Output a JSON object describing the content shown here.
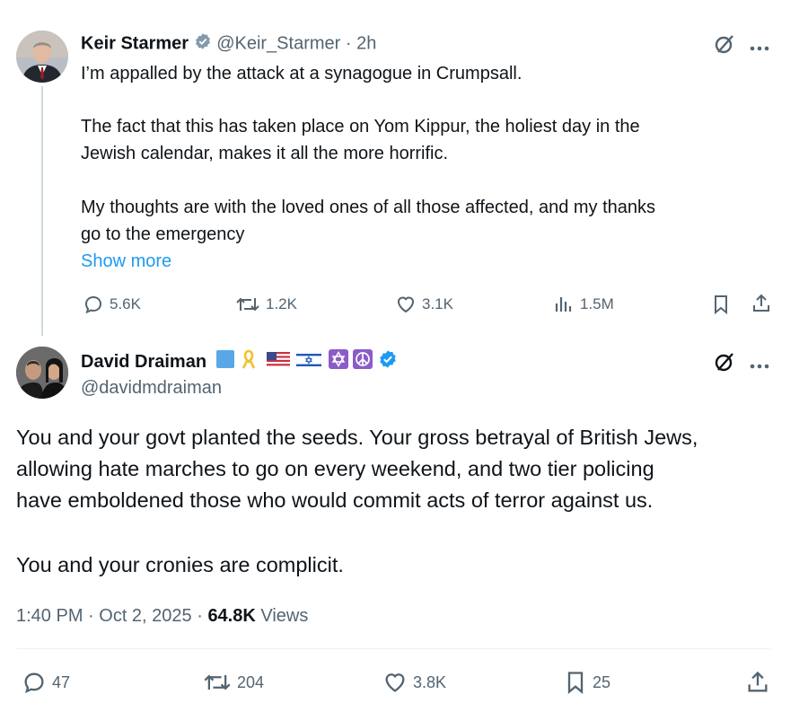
{
  "tweet1": {
    "author_name": "Keir Starmer",
    "handle": "@Keir_Starmer",
    "separator": "·",
    "time": "2h",
    "paragraphs": [
      "I’m appalled by the attack at a synagogue in Crumpsall.",
      "The fact that this has taken place on Yom Kippur, the holiest day in the",
      "Jewish calendar, makes it all the more horrific.",
      "My thoughts are with the loved ones of all those affected, and my thanks",
      "go to the emergency"
    ],
    "show_more": "Show more",
    "stats": {
      "replies": "5.6K",
      "reposts": "1.2K",
      "likes": "3.1K",
      "views": "1.5M"
    }
  },
  "tweet2": {
    "author_name": "David Draiman",
    "handle": "@davidmdraiman",
    "paragraphs": [
      "You and your govt planted the seeds. Your gross betrayal of British Jews,",
      "allowing hate marches to go on every weekend, and two tier policing",
      "have emboldened those who would commit acts of terror against us.",
      "You and your cronies are complicit."
    ],
    "timestamp": "1:40 PM · Oct 2, 2025 · ",
    "views_count": "64.8K",
    "views_label": " Views",
    "stats": {
      "replies": "47",
      "reposts": "204",
      "likes": "3.8K",
      "bookmarks": "25"
    }
  },
  "colors": {
    "accent": "#1d9bf0",
    "muted": "#536471",
    "text": "#0f1419",
    "verified": "#1d9bf0"
  },
  "icons": [
    "verified-badge-icon",
    "grok-icon",
    "more-icon",
    "reply-icon",
    "repost-icon",
    "like-icon",
    "views-icon",
    "bookmark-icon",
    "share-icon"
  ]
}
